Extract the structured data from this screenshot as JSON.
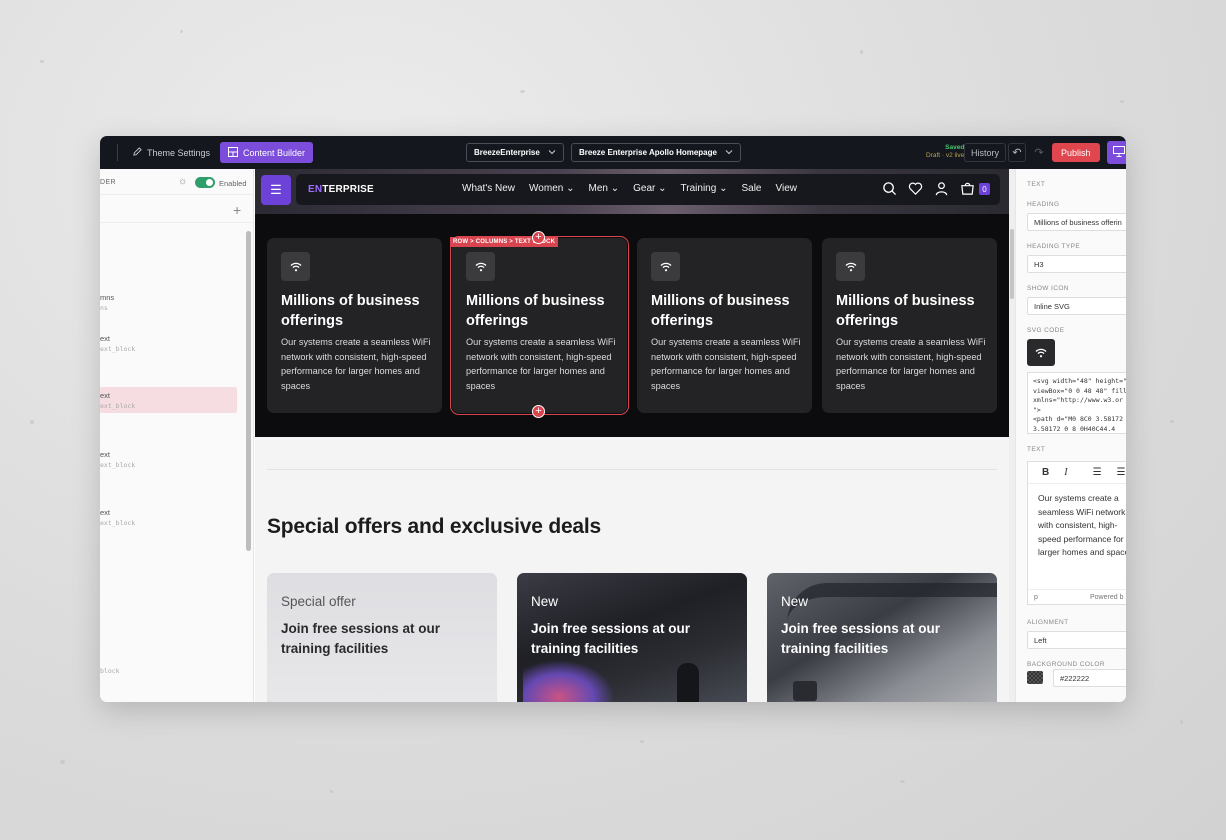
{
  "topbar": {
    "theme_settings": "Theme Settings",
    "content_builder": "Content Builder",
    "store_select": "BreezeEnterprise",
    "page_select": "Breeze Enterprise Apollo Homepage",
    "saved": "Saved",
    "draft": "Draft · v2 live",
    "history": "History",
    "publish": "Publish"
  },
  "left_panel": {
    "header": "DER",
    "enabled": "Enabled",
    "items": [
      {
        "label": "mns",
        "sub": "ns"
      },
      {
        "label": "ext",
        "sub": "ext_block"
      },
      {
        "label": "ext",
        "sub": "ext_block"
      },
      {
        "label": "ext",
        "sub": "ext_block"
      },
      {
        "label": "ext",
        "sub": "ext_block"
      }
    ],
    "bottom": "block"
  },
  "canvas": {
    "brand_prefix": "EN",
    "brand_suffix": "TERPRISE",
    "nav": [
      "What's New",
      "Women",
      "Men",
      "Gear",
      "Training",
      "Sale",
      "View"
    ],
    "nav_caret": [
      "",
      "⌄",
      "⌄",
      "⌄",
      "⌄",
      "",
      ""
    ],
    "cart_count": "0",
    "selection_label": "ROW > COLUMNS > TEXT BLOCK",
    "features": [
      {
        "title": "Millions of business offerings",
        "body": "Our systems create a seamless WiFi network with consistent, high-speed performance for larger homes and spaces"
      },
      {
        "title": "Millions of business offerings",
        "body": "Our systems create a seamless WiFi network with consistent, high-speed performance for larger homes and spaces"
      },
      {
        "title": "Millions of business offerings",
        "body": "Our systems create a seamless WiFi network with consistent, high-speed performance for larger homes and spaces"
      },
      {
        "title": "Millions of business offerings",
        "body": "Our systems create a seamless WiFi network with consistent, high-speed performance for larger homes and spaces"
      }
    ],
    "offers_title": "Special offers and exclusive deals",
    "offers": [
      {
        "tag": "Special offer",
        "heading": "Join free sessions at our training facilities"
      },
      {
        "tag": "New",
        "heading": "Join free sessions at our training facilities"
      },
      {
        "tag": "New",
        "heading": "Join free sessions at our training facilities"
      }
    ]
  },
  "right_panel": {
    "section": "TEXT",
    "heading_label": "HEADING",
    "heading_value": "Millions of business offerin",
    "heading_type_label": "HEADING TYPE",
    "heading_type_value": "H3",
    "show_icon_label": "SHOW ICON",
    "show_icon_value": "Inline SVG",
    "svg_code_label": "SVG CODE",
    "svg_code": "<svg width=\"48\" height=\"4\nviewBox=\"0 0 48 48\" fill=\"n\nxmlns=\"http://www.w3.or\n\">\n<path d=\"M0 8C0 3.58172\n3.58172 0 8 0H40C44.4",
    "text_label": "TEXT",
    "text_value": "Our systems create a seamless WiFi network with consistent, high-speed performance for larger homes and spaces",
    "editor_tag": "p",
    "powered_by": "Powered b",
    "alignment_label": "ALIGNMENT",
    "alignment_value": "Left",
    "bg_color_label": "BACKGROUND COLOR",
    "bg_color_value": "#222222"
  },
  "colors": {
    "accent": "#7c4ddb",
    "publish": "#e0464e",
    "selection": "#d9454f",
    "feature_bg": "#0c0c0e",
    "card_bg": "#232325",
    "toggle_on": "#2e9f6b"
  }
}
